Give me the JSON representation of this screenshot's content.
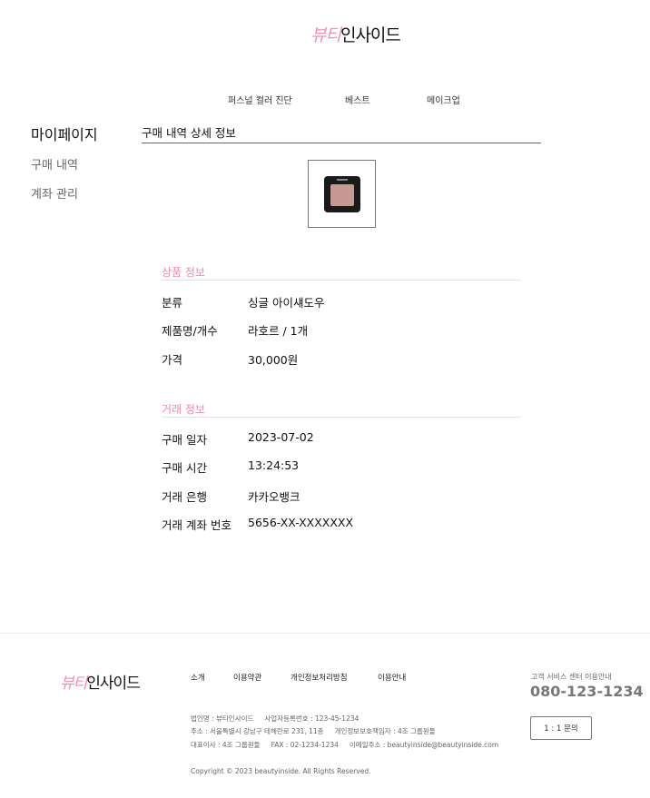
{
  "header": {
    "logo": {
      "part1": "뷰티",
      "part2": "인사이드"
    },
    "nav": [
      "퍼스널 컬러 진단",
      "베스트",
      "메이크업"
    ]
  },
  "sidebar": {
    "title": "마이페이지",
    "items": [
      "구매 내역",
      "계좌 관리"
    ]
  },
  "main": {
    "title": "구매 내역 상세 정보",
    "product_info": {
      "title": "상품 정보",
      "rows": [
        {
          "label": "분류",
          "value": "싱글 아이섀도우"
        },
        {
          "label": "제품명/개수",
          "value": "라호르 / 1개"
        },
        {
          "label": "가격",
          "value": "30,000원"
        }
      ]
    },
    "transaction_info": {
      "title": "거래 정보",
      "rows": [
        {
          "label": "구매 일자",
          "value": "2023-07-02"
        },
        {
          "label": "구매 시간",
          "value": "13:24:53"
        },
        {
          "label": "거래 은행",
          "value": "카카오뱅크"
        },
        {
          "label": "거래 계좌 번호",
          "value": "5656-XX-XXXXXXX"
        }
      ]
    }
  },
  "footer": {
    "logo": {
      "part1": "뷰티",
      "part2": "인사이드"
    },
    "links": [
      "소개",
      "이용약관",
      "개인정보처리방침",
      "이용안내"
    ],
    "info": {
      "line1": [
        "법인명 : 뷰티인사이드",
        "사업자등록번호 : 123-45-1234"
      ],
      "line2": [
        "주소 : 서울특별시 강남구 테헤란로 231, 11층",
        "개인정보보호책임자 : 4조 그룹원들"
      ],
      "line3": [
        "대표이사 : 4조 그룹원들",
        "FAX : 02-1234-1234",
        "이메일주소 : beautyinside@beautyinside.com"
      ]
    },
    "copyright": "Copyright © 2023 beautyinside. All Rights Reserved.",
    "cs_label": "고객 서비스 센터 이용안내",
    "cs_phone": "080-123-1234",
    "inquiry_button": "1 : 1 문의"
  },
  "colors": {
    "accent_pink": "#f08aa8",
    "text": "#111111",
    "muted": "#666666"
  }
}
